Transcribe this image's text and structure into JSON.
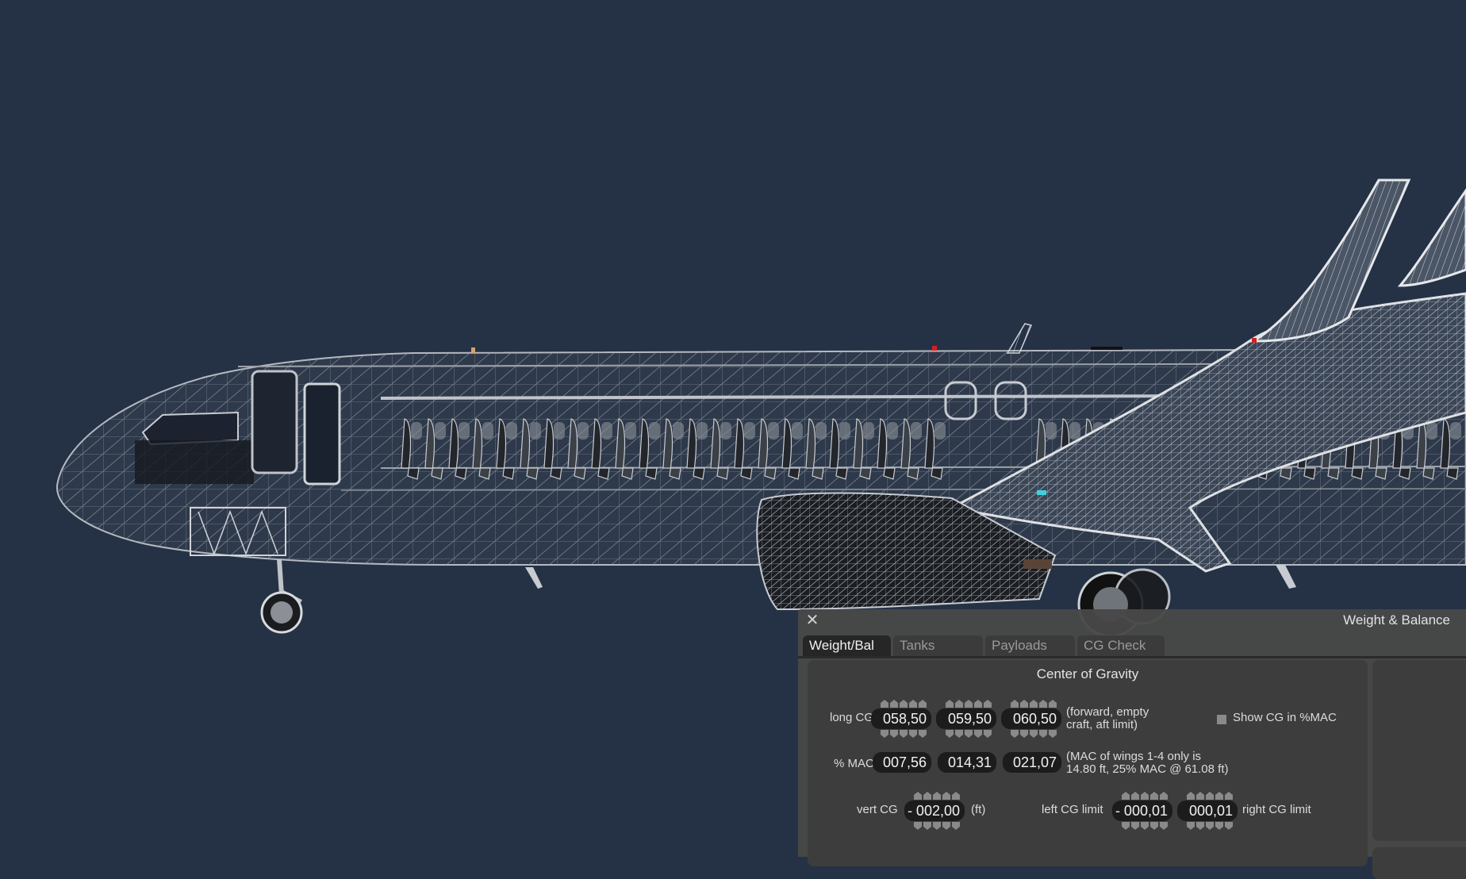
{
  "scene": {
    "background_color": "#253245",
    "object": "aircraft-wireframe-side-view"
  },
  "window": {
    "title": "Weight & Balance",
    "close_icon": "close-icon"
  },
  "tabs": [
    {
      "label": "Weight/Bal",
      "active": true
    },
    {
      "label": "Tanks",
      "active": false
    },
    {
      "label": "Payloads",
      "active": false
    },
    {
      "label": "CG Check",
      "active": false
    }
  ],
  "cg": {
    "title": "Center of Gravity",
    "long_cg": {
      "label": "long CG",
      "values": [
        "058,50",
        "059,50",
        "060,50"
      ],
      "note_line1": "(forward, empty",
      "note_line2": "craft, aft limit)"
    },
    "show_cg_mac": {
      "label": "Show CG in %MAC",
      "checked": false
    },
    "mac": {
      "label": "% MAC",
      "values": [
        "007,56",
        "014,31",
        "021,07"
      ],
      "note_line1": "(MAC of wings 1-4 only is",
      "note_line2": "14.80 ft, 25% MAC @ 61.08 ft)"
    },
    "vert_cg": {
      "label": "vert CG",
      "value": "- 002,00",
      "unit": "(ft)"
    },
    "lateral": {
      "left_label": "left CG limit",
      "left_value": "- 000,01",
      "right_value": "000,01",
      "right_label": "right CG limit"
    }
  }
}
